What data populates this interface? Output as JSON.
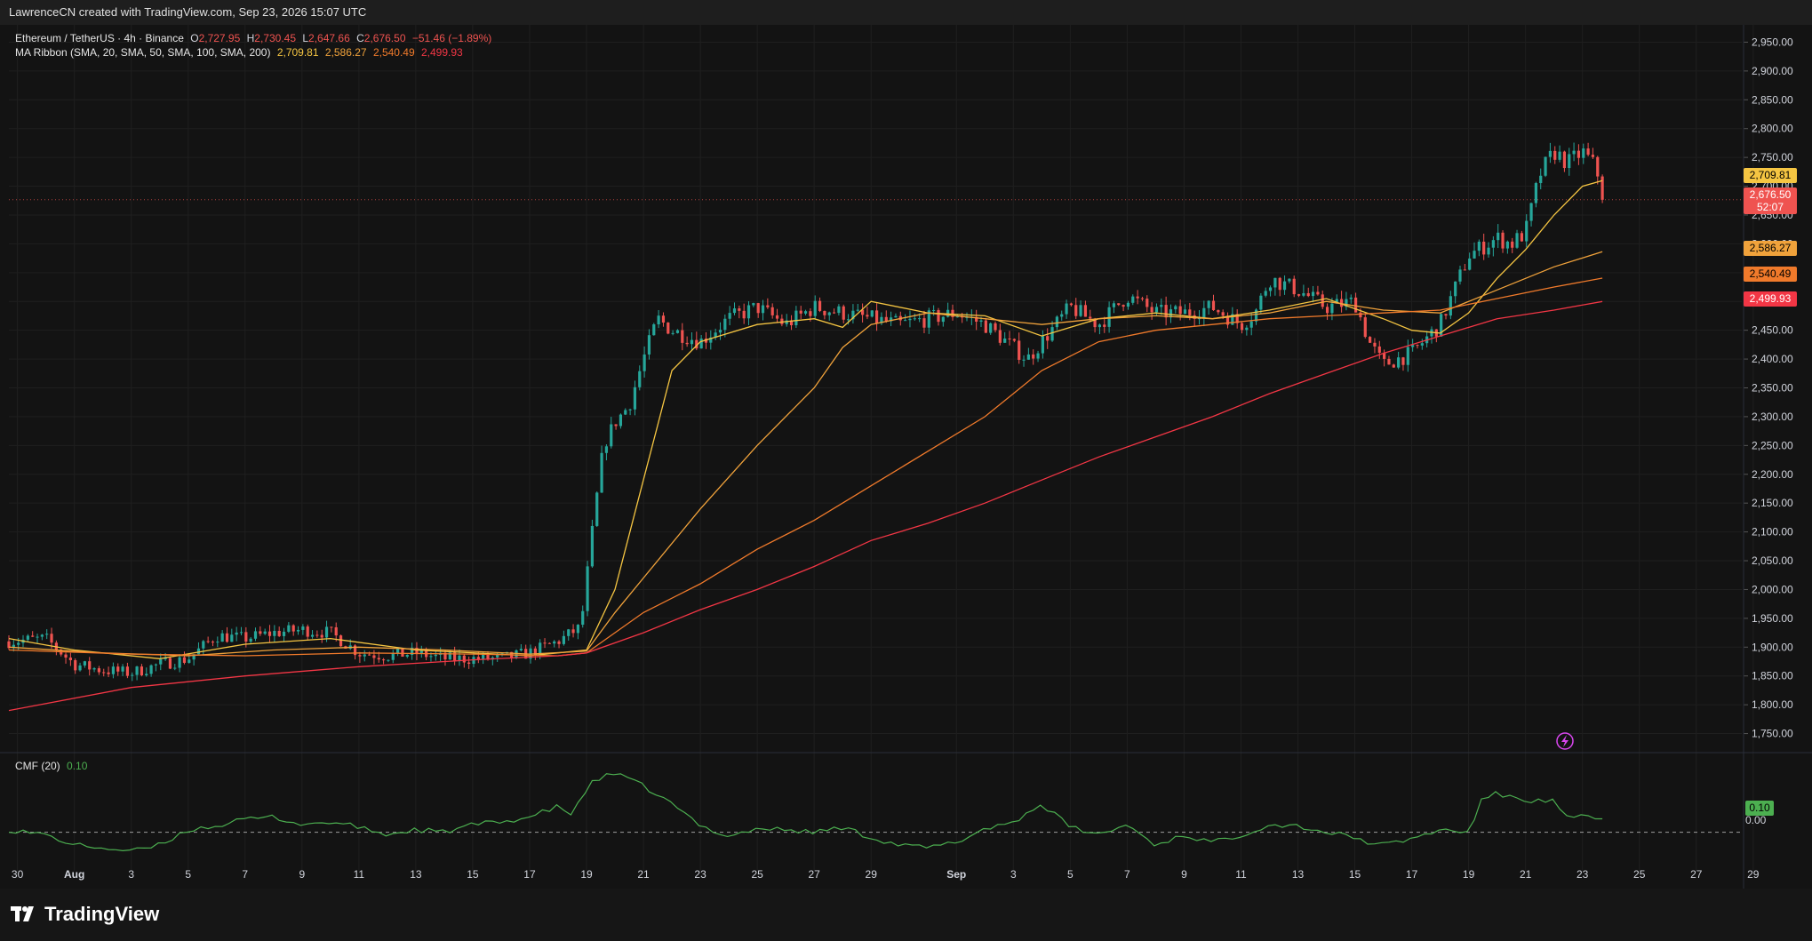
{
  "header": {
    "credit": "LawrenceCN created with TradingView.com, Sep 23, 2026 15:07 UTC"
  },
  "legend": {
    "symbol": "Ethereum / TetherUS · 4h · Binance",
    "o_label": "O",
    "o": "2,727.95",
    "h_label": "H",
    "h": "2,730.45",
    "l_label": "L",
    "l": "2,647.66",
    "c_label": "C",
    "c": "2,676.50",
    "change": "−51.46 (−1.89%)",
    "ma_label": "MA Ribbon (SMA, 20, SMA, 50, SMA, 100, SMA, 200)",
    "ma20": "2,709.81",
    "ma50": "2,586.27",
    "ma100": "2,540.49",
    "ma200": "2,499.93",
    "cmf_label": "CMF (20)",
    "cmf_value": "0.10"
  },
  "price_labels": {
    "ma20": "2,709.81",
    "last": "2,676.50",
    "countdown": "52:07",
    "ma50": "2,586.27",
    "ma100": "2,540.49",
    "ma200": "2,499.93",
    "cmf": "0.10",
    "cmf_zero": "0.00"
  },
  "colors": {
    "up": "#26a69a",
    "down": "#ef5350",
    "ma20": "#f5c542",
    "ma50": "#f0a23b",
    "ma100": "#f07a2b",
    "ma200": "#f23645",
    "cmf": "#4caf50",
    "background": "#131313"
  },
  "footer": {
    "brand": "TradingView"
  },
  "chart_data": {
    "type": "candlestick",
    "timeframe": "4h",
    "y_axis": {
      "ticks": [
        1750,
        1800,
        1850,
        1900,
        1950,
        2000,
        2050,
        2100,
        2150,
        2200,
        2250,
        2300,
        2350,
        2400,
        2450,
        2500,
        2550,
        2600,
        2650,
        2700,
        2750,
        2800,
        2850,
        2900,
        2950
      ],
      "tick_labels": [
        "1,750.00",
        "1,800.00",
        "1,850.00",
        "1,900.00",
        "1,950.00",
        "2,000.00",
        "2,050.00",
        "2,100.00",
        "2,150.00",
        "2,200.00",
        "2,250.00",
        "2,300.00",
        "2,350.00",
        "2,400.00",
        "2,450.00",
        "2,500.00",
        "2,550.00",
        "2,600.00",
        "2,650.00",
        "2,700.00",
        "2,750.00",
        "2,800.00",
        "2,850.00",
        "2,900.00",
        "2,950.00"
      ],
      "range": [
        1720,
        2980
      ]
    },
    "x_axis": {
      "range_days": [
        -0.3,
        60.6
      ],
      "ticks": [
        {
          "day": 0,
          "label": "30"
        },
        {
          "day": 2,
          "label": "Aug"
        },
        {
          "day": 4,
          "label": "3"
        },
        {
          "day": 6,
          "label": "5"
        },
        {
          "day": 8,
          "label": "7"
        },
        {
          "day": 10,
          "label": "9"
        },
        {
          "day": 12,
          "label": "11"
        },
        {
          "day": 14,
          "label": "13"
        },
        {
          "day": 16,
          "label": "15"
        },
        {
          "day": 18,
          "label": "17"
        },
        {
          "day": 20,
          "label": "19"
        },
        {
          "day": 22,
          "label": "21"
        },
        {
          "day": 24,
          "label": "23"
        },
        {
          "day": 26,
          "label": "25"
        },
        {
          "day": 28,
          "label": "27"
        },
        {
          "day": 30,
          "label": "29"
        },
        {
          "day": 33,
          "label": "Sep"
        },
        {
          "day": 35,
          "label": "3"
        },
        {
          "day": 37,
          "label": "5"
        },
        {
          "day": 39,
          "label": "7"
        },
        {
          "day": 41,
          "label": "9"
        },
        {
          "day": 43,
          "label": "11"
        },
        {
          "day": 45,
          "label": "13"
        },
        {
          "day": 47,
          "label": "15"
        },
        {
          "day": 49,
          "label": "17"
        },
        {
          "day": 51,
          "label": "19"
        },
        {
          "day": 53,
          "label": "21"
        },
        {
          "day": 55,
          "label": "23"
        },
        {
          "day": 57,
          "label": "25"
        },
        {
          "day": 59,
          "label": "27"
        },
        {
          "day": 61,
          "label": "29"
        }
      ]
    },
    "close_path": [
      [
        -0.3,
        1910
      ],
      [
        1,
        1915
      ],
      [
        2,
        1870
      ],
      [
        3,
        1860
      ],
      [
        4,
        1855
      ],
      [
        5,
        1870
      ],
      [
        6,
        1880
      ],
      [
        7,
        1920
      ],
      [
        8,
        1915
      ],
      [
        9,
        1925
      ],
      [
        10,
        1930
      ],
      [
        11,
        1925
      ],
      [
        12,
        1890
      ],
      [
        13,
        1885
      ],
      [
        14,
        1890
      ],
      [
        15,
        1880
      ],
      [
        16,
        1880
      ],
      [
        17,
        1880
      ],
      [
        18,
        1890
      ],
      [
        19,
        1910
      ],
      [
        19.8,
        1935
      ],
      [
        20.2,
        2100
      ],
      [
        20.6,
        2250
      ],
      [
        21,
        2290
      ],
      [
        21.5,
        2320
      ],
      [
        22,
        2400
      ],
      [
        22.5,
        2470
      ],
      [
        23,
        2450
      ],
      [
        24,
        2430
      ],
      [
        25,
        2470
      ],
      [
        26,
        2490
      ],
      [
        27,
        2460
      ],
      [
        28,
        2490
      ],
      [
        29,
        2480
      ],
      [
        30,
        2470
      ],
      [
        31,
        2460
      ],
      [
        32,
        2470
      ],
      [
        33,
        2480
      ],
      [
        34,
        2460
      ],
      [
        35,
        2420
      ],
      [
        35.5,
        2400
      ],
      [
        36,
        2430
      ],
      [
        37,
        2490
      ],
      [
        38,
        2460
      ],
      [
        39,
        2510
      ],
      [
        40,
        2480
      ],
      [
        41,
        2480
      ],
      [
        42,
        2490
      ],
      [
        43,
        2460
      ],
      [
        43.5,
        2480
      ],
      [
        44,
        2540
      ],
      [
        45,
        2520
      ],
      [
        46,
        2490
      ],
      [
        47,
        2500
      ],
      [
        47.5,
        2430
      ],
      [
        48,
        2390
      ],
      [
        49,
        2410
      ],
      [
        50,
        2460
      ],
      [
        50.5,
        2520
      ],
      [
        51,
        2580
      ],
      [
        52,
        2610
      ],
      [
        52.5,
        2600
      ],
      [
        53,
        2620
      ],
      [
        53.5,
        2720
      ],
      [
        54,
        2760
      ],
      [
        54.5,
        2740
      ],
      [
        55,
        2760
      ],
      [
        55.5,
        2730
      ],
      [
        55.7,
        2676.5
      ]
    ],
    "series": [
      {
        "name": "SMA 20",
        "last": 2709.81,
        "points": [
          [
            -0.3,
            1915
          ],
          [
            2,
            1895
          ],
          [
            5,
            1880
          ],
          [
            8,
            1905
          ],
          [
            11,
            1915
          ],
          [
            14,
            1895
          ],
          [
            18,
            1885
          ],
          [
            20,
            1895
          ],
          [
            21,
            2000
          ],
          [
            22,
            2190
          ],
          [
            23,
            2380
          ],
          [
            24,
            2430
          ],
          [
            26,
            2460
          ],
          [
            28,
            2470
          ],
          [
            29,
            2455
          ],
          [
            30,
            2500
          ],
          [
            32,
            2480
          ],
          [
            34,
            2475
          ],
          [
            36,
            2440
          ],
          [
            38,
            2470
          ],
          [
            40,
            2480
          ],
          [
            42,
            2470
          ],
          [
            44,
            2485
          ],
          [
            46,
            2505
          ],
          [
            48,
            2470
          ],
          [
            49,
            2450
          ],
          [
            50,
            2445
          ],
          [
            51,
            2480
          ],
          [
            52,
            2540
          ],
          [
            53,
            2590
          ],
          [
            54,
            2650
          ],
          [
            55,
            2700
          ],
          [
            55.7,
            2709.81
          ]
        ]
      },
      {
        "name": "SMA 50",
        "last": 2586.27,
        "points": [
          [
            -0.3,
            1900
          ],
          [
            3,
            1890
          ],
          [
            6,
            1885
          ],
          [
            9,
            1895
          ],
          [
            12,
            1900
          ],
          [
            15,
            1895
          ],
          [
            18,
            1888
          ],
          [
            20,
            1893
          ],
          [
            21,
            1960
          ],
          [
            22,
            2020
          ],
          [
            24,
            2140
          ],
          [
            26,
            2250
          ],
          [
            28,
            2350
          ],
          [
            29,
            2420
          ],
          [
            30,
            2460
          ],
          [
            32,
            2480
          ],
          [
            34,
            2470
          ],
          [
            36,
            2460
          ],
          [
            38,
            2470
          ],
          [
            40,
            2475
          ],
          [
            42,
            2470
          ],
          [
            44,
            2480
          ],
          [
            46,
            2500
          ],
          [
            48,
            2485
          ],
          [
            50,
            2480
          ],
          [
            52,
            2520
          ],
          [
            54,
            2560
          ],
          [
            55.7,
            2586.27
          ]
        ]
      },
      {
        "name": "SMA 100",
        "last": 2540.49,
        "points": [
          [
            -0.3,
            1895
          ],
          [
            4,
            1888
          ],
          [
            8,
            1885
          ],
          [
            12,
            1890
          ],
          [
            16,
            1888
          ],
          [
            19,
            1885
          ],
          [
            20,
            1890
          ],
          [
            22,
            1960
          ],
          [
            24,
            2010
          ],
          [
            26,
            2070
          ],
          [
            28,
            2120
          ],
          [
            30,
            2180
          ],
          [
            32,
            2240
          ],
          [
            34,
            2300
          ],
          [
            35,
            2340
          ],
          [
            36,
            2380
          ],
          [
            38,
            2430
          ],
          [
            40,
            2450
          ],
          [
            42,
            2460
          ],
          [
            44,
            2470
          ],
          [
            46,
            2475
          ],
          [
            48,
            2480
          ],
          [
            50,
            2485
          ],
          [
            52,
            2505
          ],
          [
            54,
            2525
          ],
          [
            55.7,
            2540.49
          ]
        ]
      },
      {
        "name": "SMA 200",
        "last": 2499.93,
        "points": [
          [
            -0.3,
            1790
          ],
          [
            4,
            1830
          ],
          [
            8,
            1850
          ],
          [
            12,
            1866
          ],
          [
            16,
            1878
          ],
          [
            19,
            1885
          ],
          [
            20,
            1890
          ],
          [
            22,
            1925
          ],
          [
            24,
            1965
          ],
          [
            26,
            2000
          ],
          [
            28,
            2040
          ],
          [
            30,
            2085
          ],
          [
            32,
            2115
          ],
          [
            34,
            2150
          ],
          [
            36,
            2190
          ],
          [
            38,
            2230
          ],
          [
            40,
            2265
          ],
          [
            42,
            2300
          ],
          [
            44,
            2340
          ],
          [
            46,
            2375
          ],
          [
            48,
            2410
          ],
          [
            50,
            2440
          ],
          [
            52,
            2470
          ],
          [
            54,
            2485
          ],
          [
            55.7,
            2499.93
          ]
        ]
      }
    ],
    "cmf": {
      "name": "CMF (20)",
      "last": 0.1,
      "zero": 0.0,
      "range": [
        -0.3,
        0.6
      ],
      "points": [
        [
          -0.3,
          0.02
        ],
        [
          1,
          -0.02
        ],
        [
          2,
          -0.1
        ],
        [
          3,
          -0.12
        ],
        [
          4,
          -0.15
        ],
        [
          5,
          -0.1
        ],
        [
          6,
          0.02
        ],
        [
          7,
          0.05
        ],
        [
          8,
          0.1
        ],
        [
          9,
          0.12
        ],
        [
          10,
          0.06
        ],
        [
          11,
          0.08
        ],
        [
          12,
          0.04
        ],
        [
          13,
          -0.02
        ],
        [
          14,
          0.02
        ],
        [
          15,
          0.0
        ],
        [
          16,
          0.06
        ],
        [
          17,
          0.08
        ],
        [
          18,
          0.12
        ],
        [
          19,
          0.2
        ],
        [
          19.5,
          0.14
        ],
        [
          20.2,
          0.4
        ],
        [
          21,
          0.46
        ],
        [
          22,
          0.36
        ],
        [
          23,
          0.22
        ],
        [
          24,
          0.05
        ],
        [
          25,
          -0.03
        ],
        [
          26,
          0.03
        ],
        [
          27,
          0.02
        ],
        [
          28,
          0.0
        ],
        [
          29,
          0.04
        ],
        [
          30,
          -0.04
        ],
        [
          31,
          -0.1
        ],
        [
          32,
          -0.12
        ],
        [
          33,
          -0.08
        ],
        [
          34,
          0.03
        ],
        [
          35,
          0.08
        ],
        [
          35.5,
          0.15
        ],
        [
          36,
          0.22
        ],
        [
          37,
          0.04
        ],
        [
          38,
          -0.02
        ],
        [
          39,
          0.06
        ],
        [
          40,
          -0.1
        ],
        [
          41,
          -0.02
        ],
        [
          42,
          -0.08
        ],
        [
          43,
          -0.02
        ],
        [
          44,
          0.06
        ],
        [
          45,
          0.05
        ],
        [
          46,
          0.0
        ],
        [
          47,
          -0.04
        ],
        [
          47.5,
          -0.08
        ],
        [
          48,
          -0.1
        ],
        [
          49,
          -0.05
        ],
        [
          50,
          0.02
        ],
        [
          51,
          0.0
        ],
        [
          51.5,
          0.27
        ],
        [
          52,
          0.3
        ],
        [
          53,
          0.25
        ],
        [
          54,
          0.24
        ],
        [
          54.5,
          0.1
        ],
        [
          55,
          0.12
        ],
        [
          55.7,
          0.1
        ]
      ]
    }
  }
}
